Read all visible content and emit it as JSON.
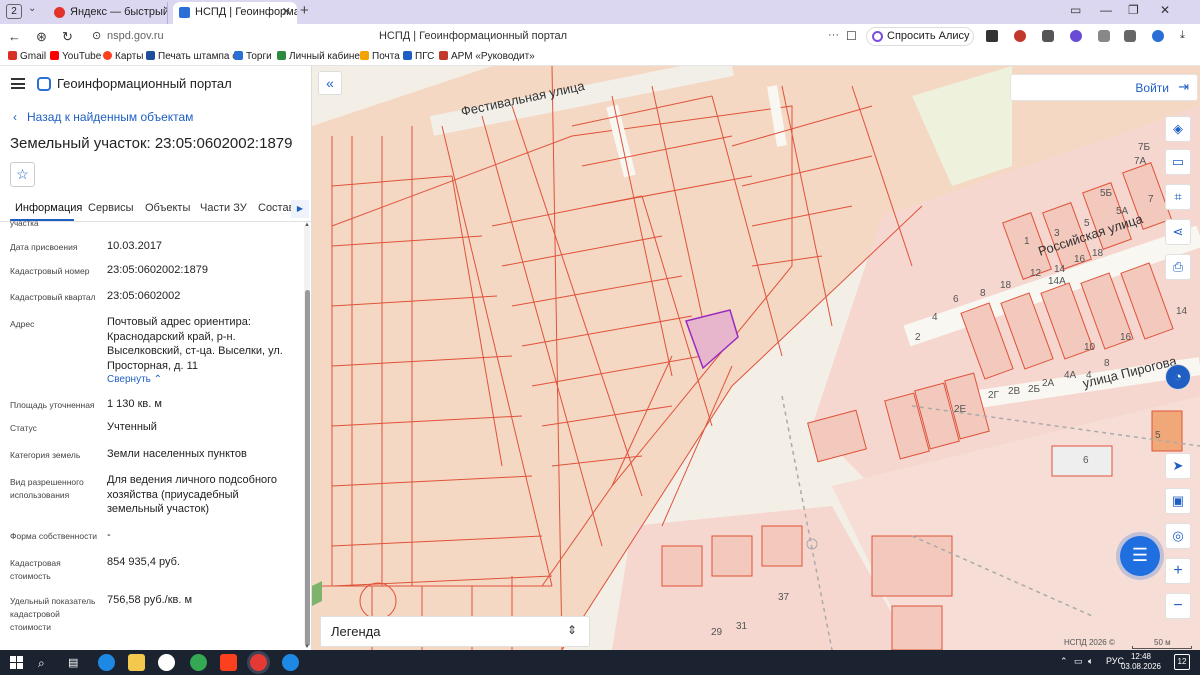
{
  "browser": {
    "tab_count": "2",
    "tabs": [
      {
        "title": "Яндекс — быстрый поиск",
        "active": false
      },
      {
        "title": "НСПД | Геоинформационн",
        "active": true
      }
    ],
    "url": "nspd.gov.ru",
    "page_title": "НСПД | Геоинформационный портал",
    "alice_button": "Спросить Алису AI"
  },
  "bookmarks": [
    "Gmail",
    "YouTube",
    "Карты",
    "Печать штампа с",
    "Торги",
    "Личный кабинет",
    "Почта",
    "ПГС",
    "АРМ «Руководит»"
  ],
  "sidebar": {
    "brand": "Геоинформационный портал",
    "back_link": "Назад к найденным объектам",
    "title": "Земельный участок: 23:05:0602002:1879",
    "tabs": [
      "Информация",
      "Сервисы",
      "Объекты",
      "Части ЗУ",
      "Состав"
    ],
    "cut_label": "участка",
    "fields": [
      {
        "label": "Дата присвоения",
        "value": "10.03.2017"
      },
      {
        "label": "Кадастровый номер",
        "value": "23:05:0602002:1879"
      },
      {
        "label": "Кадастровый квартал",
        "value": "23:05:0602002"
      },
      {
        "label": "Адрес",
        "value": "Почтовый адрес ориентира: Краснодарский край, р-н. Выселковский, ст-ца. Выселки, ул. Просторная, д. 11"
      },
      {
        "label": "Площадь уточненная",
        "value": "1 130 кв. м"
      },
      {
        "label": "Статус",
        "value": "Учтенный"
      },
      {
        "label": "Категория земель",
        "value": "Земли населенных пунктов"
      },
      {
        "label": "Вид разрешенного использования",
        "value": "Для ведения личного подсобного хозяйства (приусадебный земельный участок)"
      },
      {
        "label": "Форма собственности",
        "value": "-"
      },
      {
        "label": "Кадастровая стоимость",
        "value": "854 935,4 руб."
      },
      {
        "label": "Удельный показатель кадастровой стоимости",
        "value": "756,58 руб./кв. м"
      }
    ],
    "collapse_link": "Свернуть"
  },
  "map": {
    "login": "Войти",
    "legend": "Легенда",
    "copyright": "НСПД 2026 ©",
    "scale": "50 м",
    "streets": [
      "Фестивальная улица",
      "Российская улица",
      "улица Пирогова"
    ],
    "house_numbers": [
      "7Б",
      "7А",
      "5Б",
      "5А",
      "7",
      "5",
      "3",
      "1",
      "16",
      "18",
      "14",
      "14А",
      "12",
      "6",
      "8",
      "18",
      "4",
      "16",
      "2",
      "10",
      "8",
      "4А",
      "4",
      "2А",
      "2Б",
      "2В",
      "2Г",
      "2Е",
      "5",
      "6",
      "37",
      "31",
      "29",
      "14"
    ],
    "colors": {
      "parcel_stroke": "#e0523a",
      "selected_parcel": "#9a2bbf",
      "parcel_fill": "#f6d7cf"
    }
  },
  "taskbar": {
    "lang": "РУС",
    "time": "12:48",
    "date": "03.08.2026",
    "notif": "12"
  }
}
